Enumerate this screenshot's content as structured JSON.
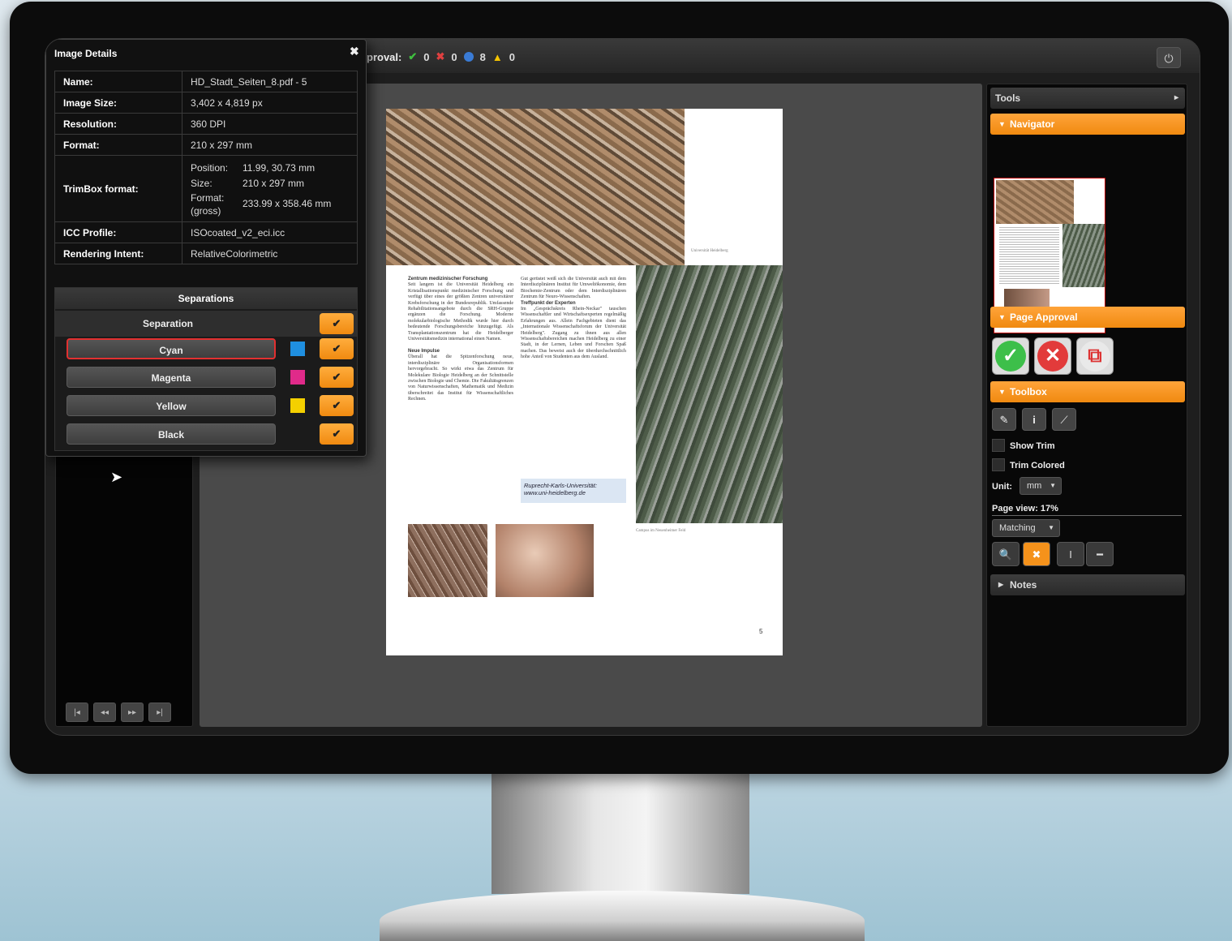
{
  "topbar": {
    "approval_label": "proval:",
    "approved_count": "0",
    "rejected_count": "0",
    "pending_count": "8",
    "warning_count": "0",
    "power_icon": "⏻"
  },
  "image_details": {
    "title": "Image Details",
    "close_glyph": "✖",
    "rows": [
      {
        "key": "Name:",
        "value": "HD_Stadt_Seiten_8.pdf - 5"
      },
      {
        "key": "Image Size:",
        "value": "3,402 x 4,819 px"
      },
      {
        "key": "Resolution:",
        "value": "360 DPI"
      },
      {
        "key": "Format:",
        "value": "210 x 297 mm"
      }
    ],
    "trimbox": {
      "key": "TrimBox format:",
      "position_label": "Position:",
      "position_value": "11.99, 30.73 mm",
      "size_label": "Size:",
      "size_value": "210 x 297 mm",
      "format_label": "Format: (gross)",
      "format_value": "233.99 x 358.46 mm"
    },
    "rows_after": [
      {
        "key": "ICC Profile:",
        "value": "ISOcoated_v2_eci.icc"
      },
      {
        "key": "Rendering Intent:",
        "value": "RelativeColorimetric"
      }
    ],
    "separations": {
      "title": "Separations",
      "header": "Separation",
      "check_glyph": "✔",
      "items": [
        {
          "label": "Cyan",
          "color": "#1f8fe0"
        },
        {
          "label": "Magenta",
          "color": "#e02a8a"
        },
        {
          "label": "Yellow",
          "color": "#f4d000"
        },
        {
          "label": "Black",
          "color": ""
        }
      ]
    }
  },
  "left_nav": {
    "first": "|◂",
    "prev": "◂◂",
    "next": "▸▸",
    "last": "▸|"
  },
  "document": {
    "col1_heading": "Zentrum medizinischer Forschung",
    "col1_text": "Seit langem ist die Universität Heidelberg ein Kristallisationspunkt medizinischer Forschung und verfügt über eines der größten Zentren universitärer Krebsforschung in der Bundesrepublik. Umfassende Rehabilitationsangebote durch die SRH-Gruppe ergänzen die Forschung. Moderne molekularbiologische Methodik wurde hier durch bedeutende Forschungsbereiche hinzugefügt. Als Transplantationszentrum hat die Heidelberger Universitätsmedizin international einen Namen.",
    "col1_heading2": "Neue Impulse",
    "col1_text2": "Überall hat die Spitzenforschung neue, interdisziplinäre Organisationsformen hervorgebracht. So wirkt etwa das Zentrum für Molekulare Biologie Heidelberg an der Schnittstelle zwischen Biologie und Chemie. Die Fakultätsgrenzen von Naturwissenschaften, Mathematik und Medizin überschreitet das Institut für Wissenschaftliches Rechnen.",
    "col2_text": "Gut gerüstet weiß sich die Universität auch mit dem Interdisziplinären Institut für Umweltökonomie, dem Biochemie-Zentrum oder dem Interdisziplinären Zentrum für Neuro-Wissenschaften.",
    "col2_heading": "Treffpunkt der Experten",
    "col2_text2": "Im „Gesprächskreis Rhein-Neckar\" tauschen Wissenschaftler und Wirtschaftsexperten regelmäßig Erfahrungen aus. Allein Fachgebieten dient das „Internationale Wissenschaftsforum der Universität Heidelberg\". Zugang zu ihnen aus allen Wissenschaftsbereichen machen Heidelberg zu einer Stadt, in der Lernen, Leben und Forschen Spaß machen. Das beweist auch der überdurchschnittlich hohe Anteil von Studenten aus dem Ausland.",
    "info_box": "Ruprecht-Karls-Universität: www.uni-heidelberg.de",
    "caption_top": "Universität Heidelberg",
    "caption_right": "Campus im Neuenheimer Feld",
    "page_number": "5"
  },
  "tools": {
    "title": "Tools",
    "expand_glyph": "▸",
    "navigator": "Navigator",
    "page_approval": "Page Approval",
    "approve_glyph": "✓",
    "reject_glyph": "✕",
    "compare_glyph": "⧉",
    "toolbox": "Toolbox",
    "eyedropper_glyph": "✎",
    "info_glyph": "i",
    "ruler_glyph": "⟋",
    "show_trim": "Show Trim",
    "trim_colored": "Trim Colored",
    "unit_label": "Unit:",
    "unit_value": "mm",
    "page_view_label": "Page view:",
    "page_view_value": "17%",
    "matching_value": "Matching",
    "zoom_glyph": "🔍",
    "fit_glyph": "✖",
    "fit_height_glyph": "I",
    "fit_width_glyph": "━",
    "notes": "Notes",
    "accent_color": "#f5921b"
  }
}
